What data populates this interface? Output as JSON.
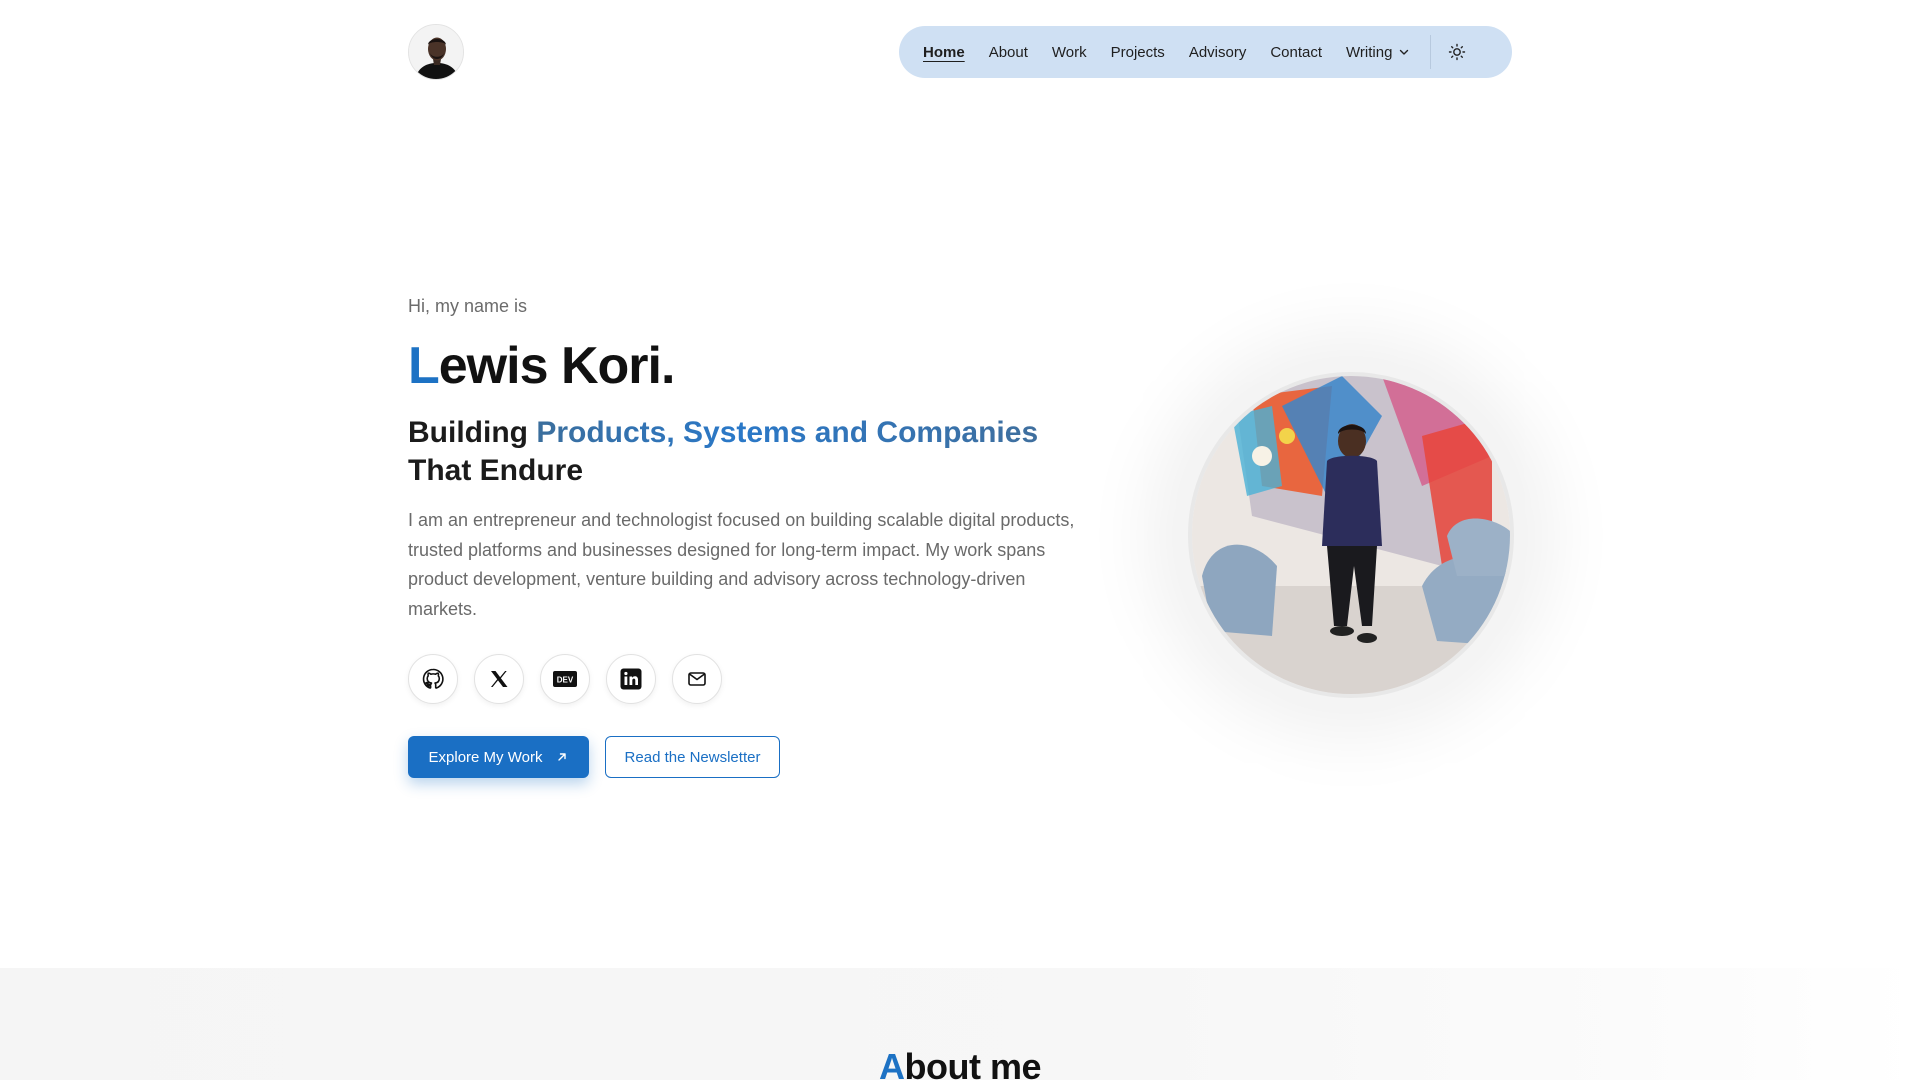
{
  "header": {
    "nav": {
      "items": [
        {
          "label": "Home",
          "active": true
        },
        {
          "label": "About"
        },
        {
          "label": "Work"
        },
        {
          "label": "Projects"
        },
        {
          "label": "Advisory"
        },
        {
          "label": "Contact"
        },
        {
          "label": "Writing",
          "has_dropdown": true
        }
      ],
      "theme_toggle_icon": "sun-icon"
    },
    "avatar_icon": "profile-avatar"
  },
  "hero": {
    "intro": "Hi, my name is",
    "name_first_letter": "L",
    "name_rest": "ewis Kori.",
    "tagline_start": "Building ",
    "tagline_accent": "Products, Systems and Companies",
    "tagline_line2": "That Endure",
    "description": "I am an entrepreneur and technologist focused on building scalable digital products, trusted platforms and businesses designed for long-term impact. My work spans product development, venture building and advisory across technology-driven markets.",
    "socials": [
      {
        "icon": "github-icon"
      },
      {
        "icon": "x-icon"
      },
      {
        "icon": "dev-icon",
        "text": "DEV"
      },
      {
        "icon": "linkedin-icon"
      },
      {
        "icon": "mail-icon"
      }
    ],
    "primary_button": "Explore My Work",
    "secondary_button": "Read the Newsletter"
  },
  "about": {
    "title_first_letter": "A",
    "title_rest": "bout me"
  },
  "colors": {
    "accent": "#1a6fc4",
    "nav_bg": "#cfe0f3"
  }
}
